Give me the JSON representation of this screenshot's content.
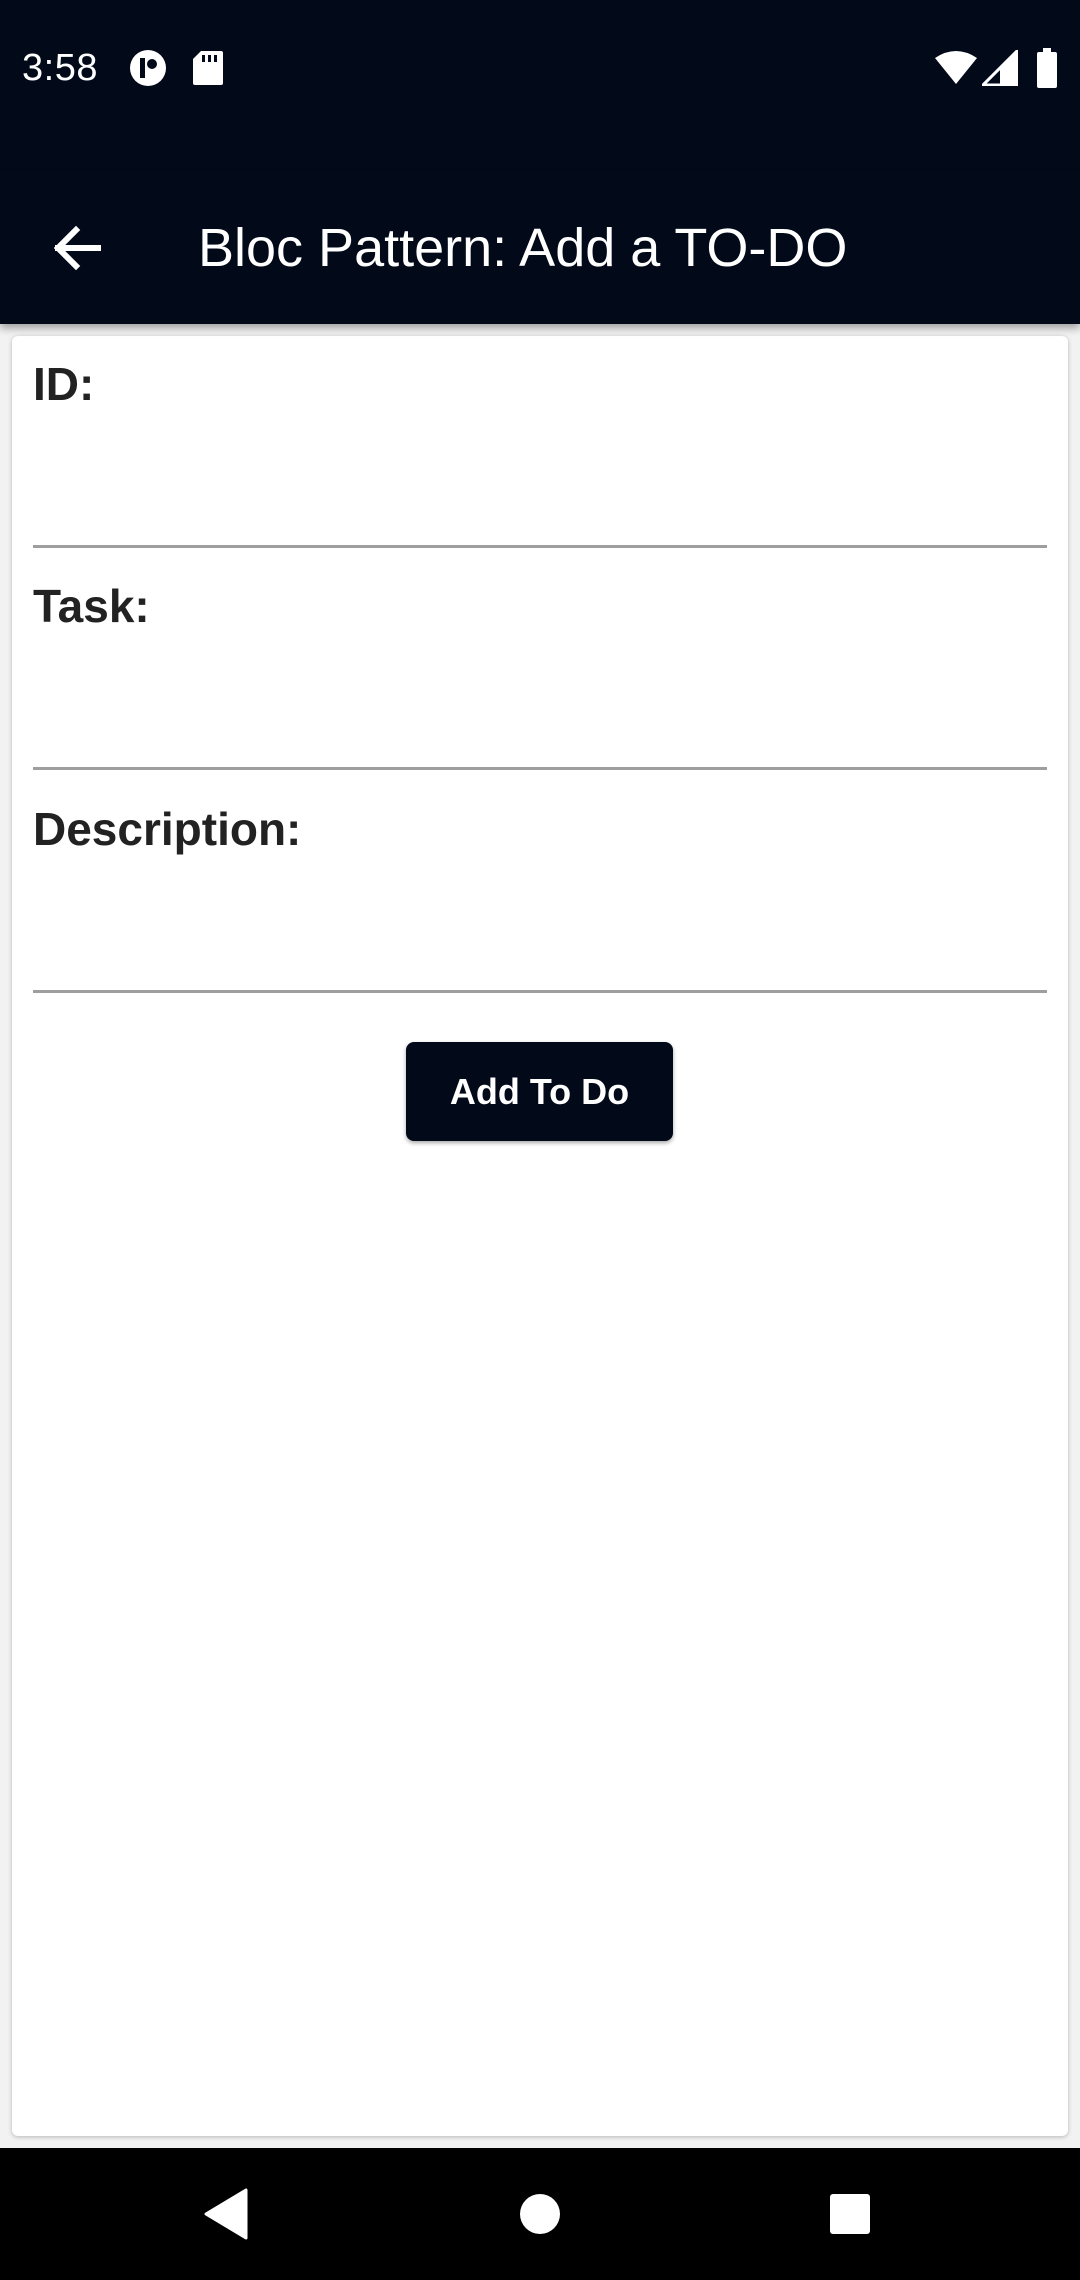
{
  "status_bar": {
    "time": "3:58",
    "left_icons": [
      "media-icon",
      "sd-card-icon"
    ],
    "right_icons": [
      "wifi-icon",
      "cell-signal-icon",
      "battery-icon"
    ]
  },
  "app_bar": {
    "title": "Bloc Pattern: Add a TO-DO",
    "back_icon": "arrow-back-icon"
  },
  "form": {
    "id_label": "ID:",
    "id_value": "",
    "task_label": "Task:",
    "task_value": "",
    "description_label": "Description:",
    "description_value": "",
    "submit_label": "Add To Do"
  },
  "nav_bar": {
    "back": "nav-back-icon",
    "home": "nav-home-icon",
    "recents": "nav-recents-icon"
  },
  "colors": {
    "bar_background": "#020a1a",
    "button_background": "#020a1a",
    "card_background": "#ffffff",
    "underline": "#9e9e9e",
    "label_text": "#222222"
  }
}
